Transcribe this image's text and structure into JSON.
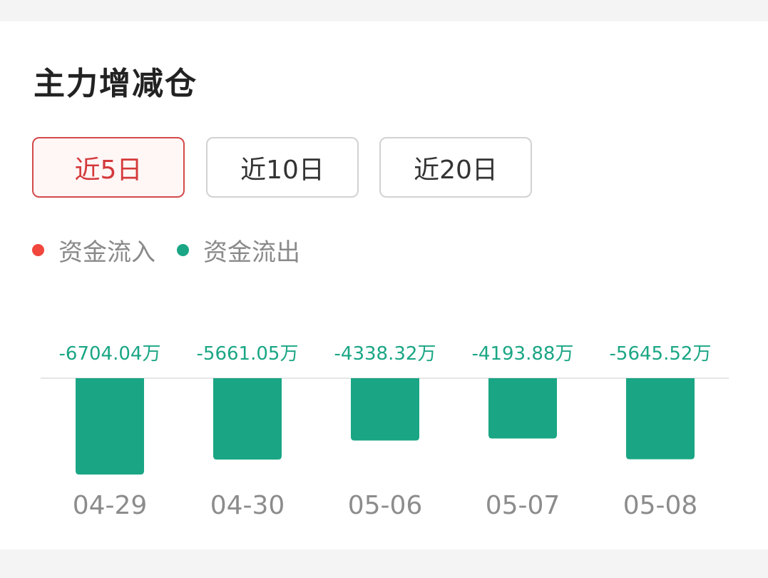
{
  "header": {
    "title": "主力增减仓"
  },
  "tabs": [
    {
      "label": "近5日",
      "active": true
    },
    {
      "label": "近10日",
      "active": false
    },
    {
      "label": "近20日",
      "active": false
    }
  ],
  "legend": [
    {
      "label": "资金流入",
      "color": "#f0463c"
    },
    {
      "label": "资金流出",
      "color": "#1aa684"
    }
  ],
  "colors": {
    "accent": "#d4393b",
    "inflow": "#f0463c",
    "outflow": "#1aa684"
  },
  "chart_data": {
    "type": "bar",
    "categories": [
      "04-29",
      "04-30",
      "05-06",
      "05-07",
      "05-08"
    ],
    "values": [
      -6704.04,
      -5661.05,
      -4338.32,
      -4193.88,
      -5645.52
    ],
    "data_labels": [
      "-6704.04万",
      "-5661.05万",
      "-4338.32万",
      "-4193.88万",
      "-5645.52万"
    ],
    "unit": "万",
    "grid": false
  }
}
